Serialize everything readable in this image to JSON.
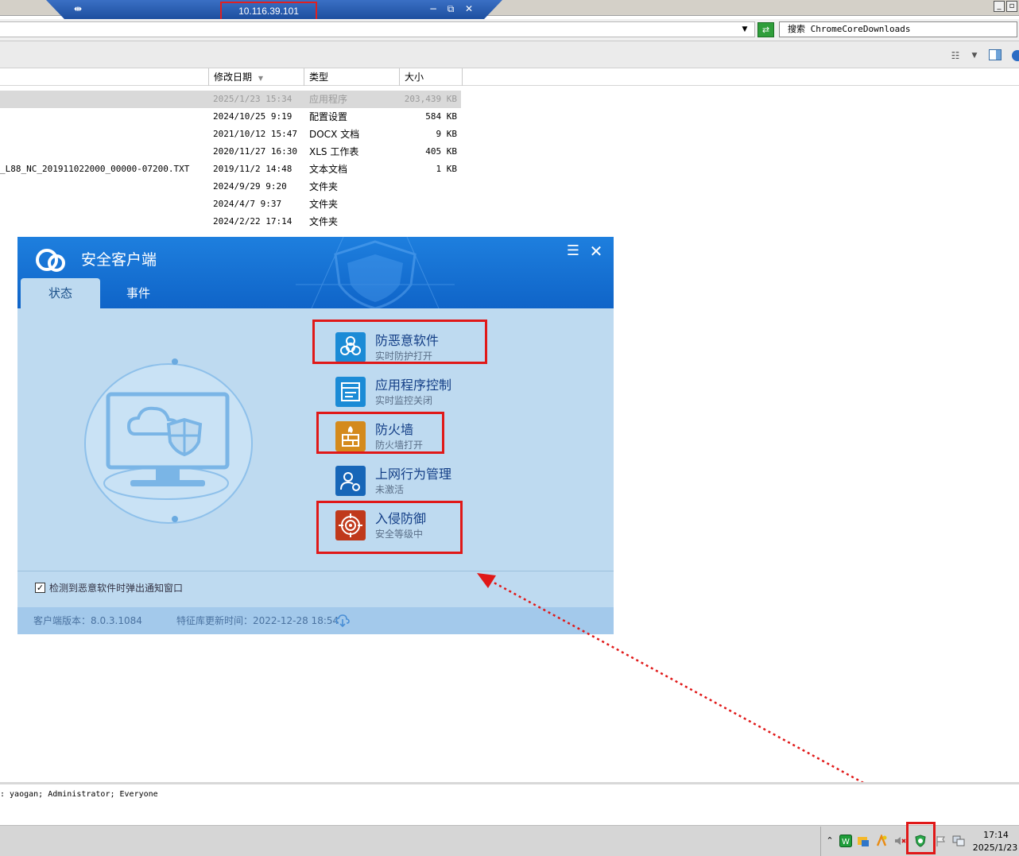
{
  "remote_session": {
    "host_ip": "10.116.39.101",
    "pin_glyph": "⇹",
    "minimize_glyph": "−",
    "restore_glyph": "⧉",
    "close_glyph": "✕"
  },
  "explorer": {
    "search_text": "搜索 ChromeCoreDownloads",
    "columns": {
      "modified": "修改日期",
      "type": "类型",
      "size": "大小"
    },
    "files": [
      {
        "name": "",
        "modified": "2025/1/23 15:34",
        "type": "应用程序",
        "size": "203,439 KB",
        "selected": true
      },
      {
        "name": "",
        "modified": "2024/10/25 9:19",
        "type": "配置设置",
        "size": "584 KB"
      },
      {
        "name": "",
        "modified": "2021/10/12 15:47",
        "type": "DOCX 文档",
        "size": "9 KB"
      },
      {
        "name": "",
        "modified": "2020/11/27 16:30",
        "type": "XLS 工作表",
        "size": "405 KB"
      },
      {
        "name": "_L88_NC_201911022000_00000-07200.TXT",
        "modified": "2019/11/2 14:48",
        "type": "文本文档",
        "size": "1 KB"
      },
      {
        "name": "",
        "modified": "2024/9/29 9:20",
        "type": "文件夹",
        "size": ""
      },
      {
        "name": "",
        "modified": "2024/4/7 9:37",
        "type": "文件夹",
        "size": ""
      },
      {
        "name": "",
        "modified": "2024/2/22 17:14",
        "type": "文件夹",
        "size": ""
      }
    ],
    "details_text": ": yaogan; Administrator; Everyone"
  },
  "security_client": {
    "title": "安全客户端",
    "tabs": [
      "状态",
      "事件"
    ],
    "active_tab": "状态",
    "features": [
      {
        "title": "防恶意软件",
        "status": "实时防护打开",
        "icon": "biohazard-icon",
        "color": "#1b8bd6",
        "highlighted": true
      },
      {
        "title": "应用程序控制",
        "status": "实时监控关闭",
        "icon": "app-window-icon",
        "color": "#1b8bd6",
        "highlighted": false
      },
      {
        "title": "防火墙",
        "status": "防火墙打开",
        "icon": "firewall-icon",
        "color": "#d48a1c",
        "highlighted": true
      },
      {
        "title": "上网行为管理",
        "status": "未激活",
        "icon": "user-gear-icon",
        "color": "#1766b8",
        "highlighted": false
      },
      {
        "title": "入侵防御",
        "status": "安全等级中",
        "icon": "target-icon",
        "color": "#c0391b",
        "highlighted": true
      }
    ],
    "notify_checkbox": {
      "label": "检测到恶意软件时弹出通知窗口",
      "checked": true
    },
    "version_label": "客户端版本：8.0.3.1084",
    "signature_label": "特征库更新时间：2022-12-28 18:54"
  },
  "taskbar": {
    "time": "17:14",
    "date": "2025/1/23"
  },
  "colors": {
    "highlight_red": "#e01818",
    "client_blue": "#0f64c8"
  }
}
